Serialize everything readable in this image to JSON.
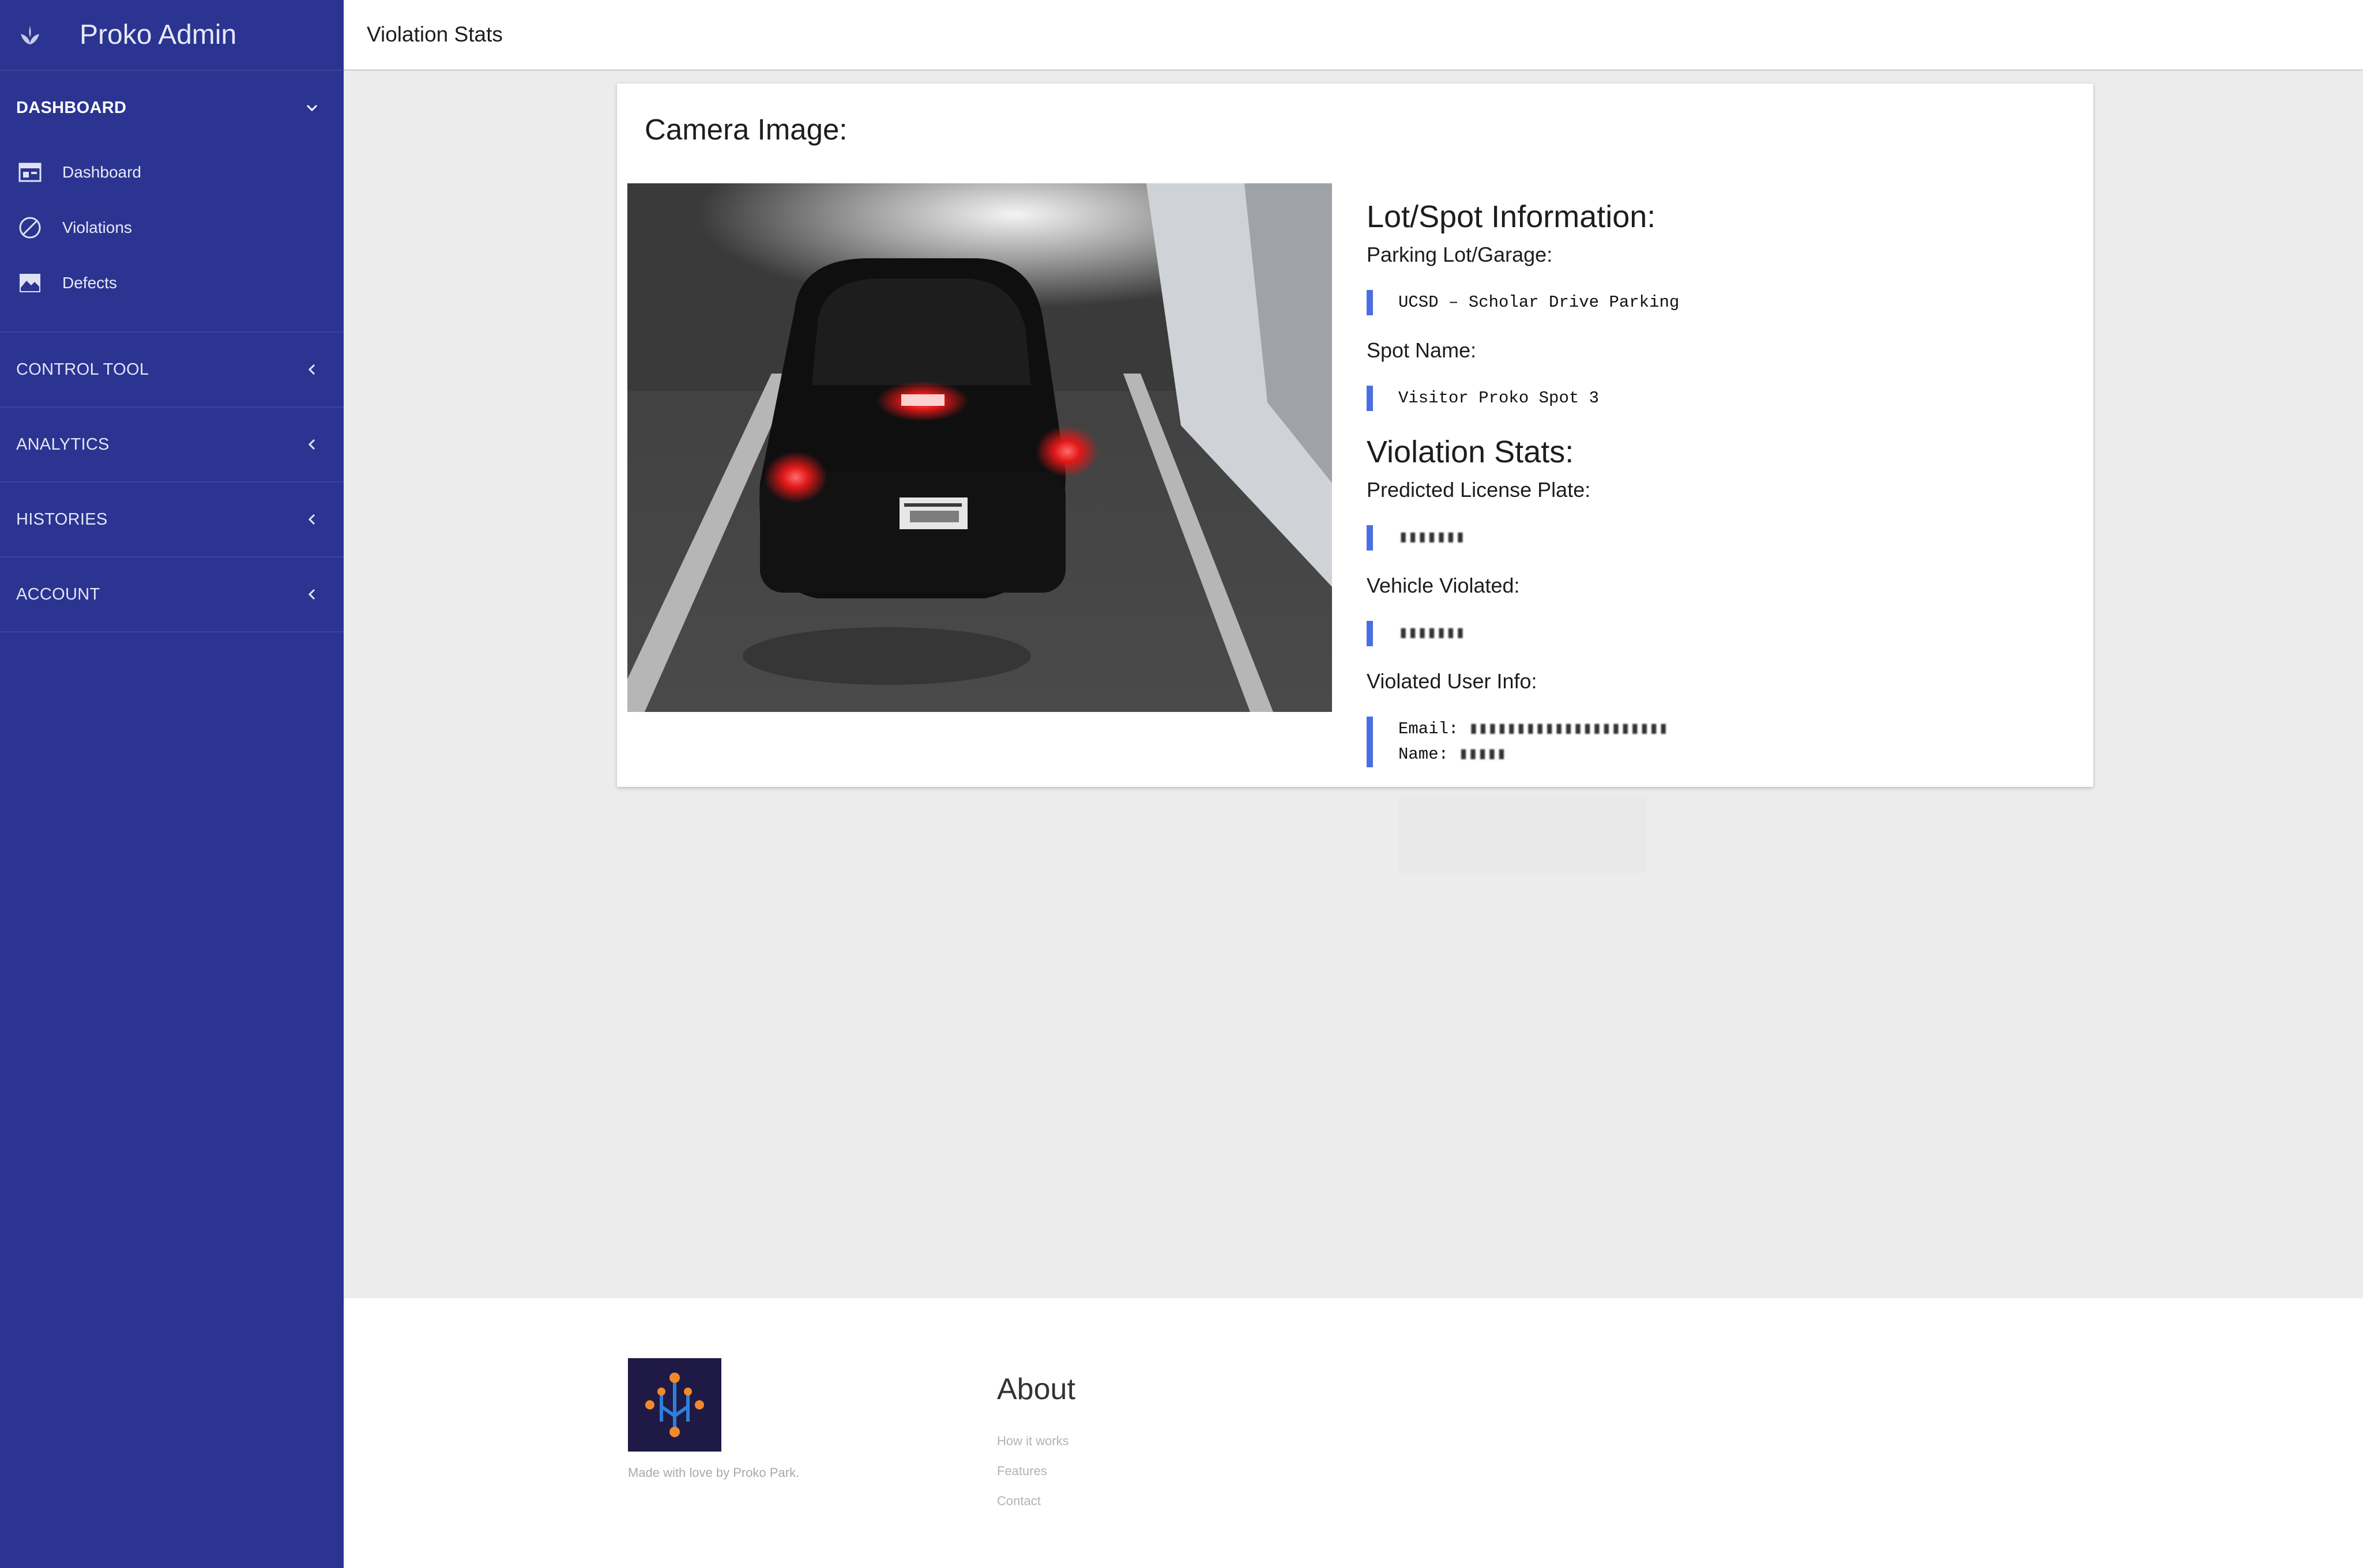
{
  "app": {
    "title": "Proko Admin"
  },
  "topbar": {
    "title": "Violation Stats"
  },
  "sidebar": {
    "dashboard_section": {
      "label": "DASHBOARD",
      "items": [
        {
          "label": "Dashboard",
          "icon": "dashboard-icon"
        },
        {
          "label": "Violations",
          "icon": "prohibited-icon"
        },
        {
          "label": "Defects",
          "icon": "image-icon"
        }
      ]
    },
    "collapsed_sections": [
      {
        "label": "CONTROL TOOL"
      },
      {
        "label": "ANALYTICS"
      },
      {
        "label": "HISTORIES"
      },
      {
        "label": "ACCOUNT"
      }
    ]
  },
  "card": {
    "title": "Camera Image:",
    "lot_heading": "Lot/Spot Information:",
    "parking_label": "Parking Lot/Garage:",
    "parking_value": "UCSD – Scholar Drive Parking",
    "spot_label": "Spot Name:",
    "spot_value": "Visitor Proko Spot 3",
    "violation_heading": "Violation Stats:",
    "plate_label": "Predicted License Plate:",
    "vehicle_label": "Vehicle Violated:",
    "user_label": "Violated User Info:",
    "email_label": "Email:",
    "name_label": "Name:"
  },
  "footer": {
    "made_with": "Made with love by Proko Park.",
    "about_heading": "About",
    "links": [
      "How it works",
      "Features",
      "Contact"
    ]
  },
  "colors": {
    "sidebar": "#2b3490",
    "accent_bar": "#4a6fe3"
  }
}
